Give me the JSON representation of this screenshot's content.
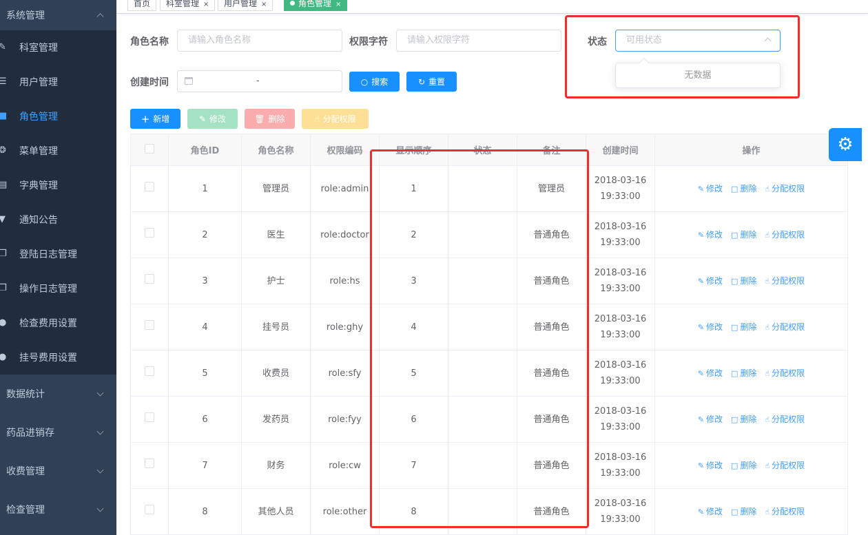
{
  "sidebar": {
    "group_system": "系统管理",
    "items": [
      {
        "label": "科室管理",
        "icon": "edit-icon"
      },
      {
        "label": "用户管理",
        "icon": "list-icon"
      },
      {
        "label": "角色管理",
        "icon": "folder-icon"
      },
      {
        "label": "菜单管理",
        "icon": "bug-icon"
      },
      {
        "label": "字典管理",
        "icon": "dict-icon"
      },
      {
        "label": "通知公告",
        "icon": "shirt-icon"
      },
      {
        "label": "登陆日志管理",
        "icon": "copy-icon"
      },
      {
        "label": "操作日志管理",
        "icon": "copy-icon"
      },
      {
        "label": "检查费用设置",
        "icon": "globe-icon"
      },
      {
        "label": "挂号费用设置",
        "icon": "globe-icon"
      }
    ],
    "groups": [
      "数据统计",
      "药品进销存",
      "收费管理",
      "检查管理"
    ]
  },
  "tags": {
    "home": "首页",
    "dept": "科室管理",
    "user": "用户管理",
    "role": "角色管理",
    "close": "×"
  },
  "search": {
    "role_name_label": "角色名称",
    "role_name_placeholder": "请输入角色名称",
    "perm_label": "权限字符",
    "perm_placeholder": "请输入权限字符",
    "status_label": "状态",
    "status_placeholder": "可用状态",
    "created_label": "创建时间",
    "range_sep": "-",
    "search_btn": "搜索",
    "reset_btn": "重置",
    "no_data": "无数据"
  },
  "toolbar": {
    "add": "新增",
    "edit": "修改",
    "delete": "删除",
    "assign": "分配权限"
  },
  "table": {
    "headers": [
      "角色ID",
      "角色名称",
      "权限编码",
      "显示顺序",
      "状态",
      "备注",
      "创建时间",
      "操作"
    ],
    "ops": {
      "edit": "修改",
      "delete": "删除",
      "assign": "分配权限"
    },
    "rows": [
      {
        "id": "1",
        "name": "管理员",
        "code": "role:admin",
        "order": "1",
        "status": "",
        "remark": "管理员",
        "date": "2018-03-16",
        "time": "19:33:00"
      },
      {
        "id": "2",
        "name": "医生",
        "code": "role:doctor",
        "order": "2",
        "status": "",
        "remark": "普通角色",
        "date": "2018-03-16",
        "time": "19:33:00"
      },
      {
        "id": "3",
        "name": "护士",
        "code": "role:hs",
        "order": "3",
        "status": "",
        "remark": "普通角色",
        "date": "2018-03-16",
        "time": "19:33:00"
      },
      {
        "id": "4",
        "name": "挂号员",
        "code": "role:ghy",
        "order": "4",
        "status": "",
        "remark": "普通角色",
        "date": "2018-03-16",
        "time": "19:33:00"
      },
      {
        "id": "5",
        "name": "收费员",
        "code": "role:sfy",
        "order": "5",
        "status": "",
        "remark": "普通角色",
        "date": "2018-03-16",
        "time": "19:33:00"
      },
      {
        "id": "6",
        "name": "发药员",
        "code": "role:fyy",
        "order": "6",
        "status": "",
        "remark": "普通角色",
        "date": "2018-03-16",
        "time": "19:33:00"
      },
      {
        "id": "7",
        "name": "财务",
        "code": "role:cw",
        "order": "7",
        "status": "",
        "remark": "普通角色",
        "date": "2018-03-16",
        "time": "19:33:00"
      },
      {
        "id": "8",
        "name": "其他人员",
        "code": "role:other",
        "order": "8",
        "status": "",
        "remark": "普通角色",
        "date": "2018-03-16",
        "time": "19:33:00"
      }
    ]
  }
}
